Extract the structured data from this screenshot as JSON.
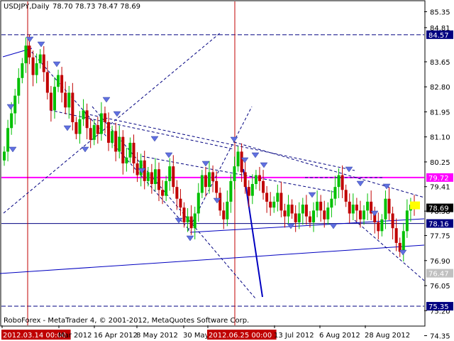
{
  "window": {
    "title": "USDJPY,Daily",
    "ohlc": "78.70 78.73 78.47 78.69",
    "copyright": "RoboForex - MetaTrader 4, © 2001-2012, MetaQuotes Software Corp."
  },
  "colors": {
    "background": "#ffffff",
    "bull_candle": "#00c000",
    "bear_candle": "#c00000",
    "trendline_blue": "#0000c0",
    "level_magenta": "#ff00ff",
    "level_navy": "#000080",
    "date_marker_red": "#c00000",
    "wave_dashed": "#000080",
    "fractal_arrow": "#6070e0",
    "current_price_badge": "#000000",
    "projection_marker": "#ffff00"
  },
  "chart_data": {
    "type": "candlestick",
    "symbol": "USDJPY",
    "timeframe": "Daily",
    "ylim": [
      74.7,
      85.7
    ],
    "x_tick_labels": [
      "2012.03.14 00:00",
      "Mar 2012",
      "16 Apr 2012",
      "8 May 2012",
      "30 May 2012",
      "2012.06.25 00:00",
      "13 Jul 2012",
      "6 Aug 2012",
      "28 Aug 2012"
    ],
    "y_tick_labels": [
      "85.35",
      "84.81",
      "83.65",
      "82.80",
      "81.95",
      "81.10",
      "80.25",
      "79.41",
      "78.58",
      "77.75",
      "76.90",
      "76.05",
      "75.20",
      "74.35"
    ],
    "price_labels": [
      {
        "value": "84.57",
        "style": "navy"
      },
      {
        "value": "79.72",
        "style": "magenta"
      },
      {
        "value": "78.69",
        "style": "current"
      },
      {
        "value": "78.16",
        "style": "navy"
      },
      {
        "value": "76.47",
        "style": "grey"
      },
      {
        "value": "75.35",
        "style": "navy"
      }
    ],
    "horizontal_levels": [
      {
        "price": 84.57,
        "color": "navy",
        "style": "dashed"
      },
      {
        "price": 79.72,
        "color": "magenta",
        "style": "solid"
      },
      {
        "price": 78.16,
        "color": "navy",
        "style": "solid-thin"
      },
      {
        "price": 75.35,
        "color": "navy",
        "style": "dashed"
      }
    ],
    "vertical_markers": [
      "2012.03.14 00:00",
      "2012.06.25 00:00"
    ],
    "closes": [
      80.6,
      81.4,
      81.9,
      82.5,
      83.1,
      83.6,
      84.2,
      83.8,
      83.2,
      83.6,
      83.9,
      83.3,
      82.6,
      82.0,
      82.8,
      83.2,
      82.6,
      82.1,
      82.6,
      81.6,
      81.2,
      81.7,
      82.0,
      81.4,
      81.0,
      81.5,
      81.2,
      81.9,
      81.6,
      80.9,
      81.3,
      80.6,
      81.1,
      80.2,
      80.4,
      80.9,
      80.2,
      79.8,
      80.3,
      79.6,
      79.9,
      79.5,
      80.0,
      79.3,
      79.1,
      79.6,
      80.1,
      79.4,
      79.0,
      78.7,
      78.2,
      78.4,
      78.0,
      78.5,
      79.2,
      79.8,
      79.4,
      79.9,
      79.6,
      79.2,
      78.6,
      78.3,
      78.9,
      79.6,
      80.1,
      80.6,
      79.9,
      79.4,
      79.1,
      79.5,
      79.8,
      79.6,
      79.2,
      78.9,
      78.7,
      78.9,
      79.2,
      78.6,
      78.4,
      78.8,
      78.5,
      78.2,
      78.5,
      78.8,
      78.4,
      78.2,
      78.6,
      78.9,
      78.6,
      78.3,
      78.7,
      79.0,
      79.4,
      79.8,
      79.3,
      78.9,
      78.5,
      78.8,
      78.6,
      78.3,
      78.6,
      78.9,
      78.5,
      78.2,
      77.9,
      78.3,
      79.0,
      78.5,
      78.0,
      77.5,
      77.2,
      77.9,
      78.6,
      78.8,
      78.7
    ]
  }
}
